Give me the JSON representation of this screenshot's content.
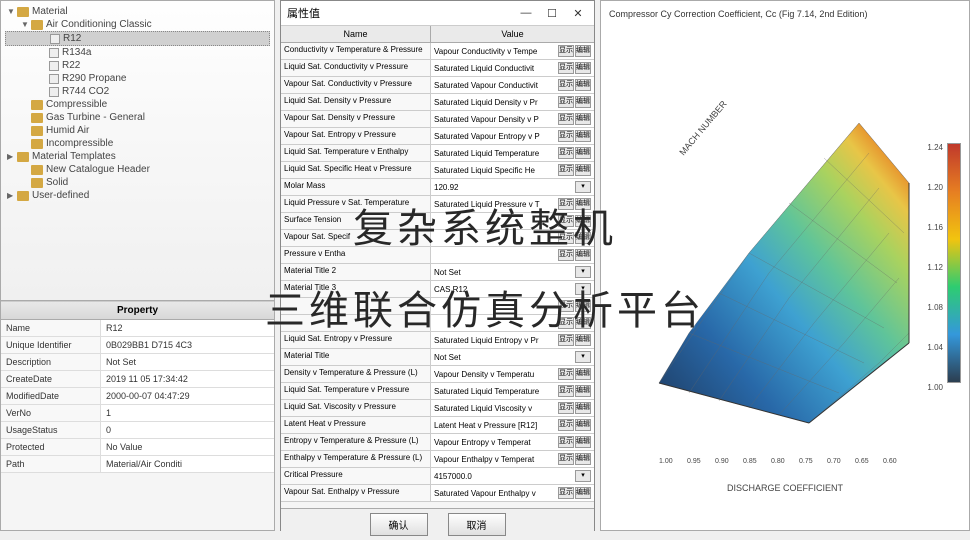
{
  "tree": {
    "root": "Material",
    "items": [
      {
        "indent": 0,
        "toggle": "▼",
        "icon": "folder",
        "label": "Material"
      },
      {
        "indent": 1,
        "toggle": "▼",
        "icon": "folder",
        "label": "Air Conditioning Classic"
      },
      {
        "indent": 2,
        "toggle": "",
        "icon": "file",
        "label": "R12",
        "selected": true
      },
      {
        "indent": 2,
        "toggle": "",
        "icon": "file",
        "label": "R134a"
      },
      {
        "indent": 2,
        "toggle": "",
        "icon": "file",
        "label": "R22"
      },
      {
        "indent": 2,
        "toggle": "",
        "icon": "file",
        "label": "R290 Propane"
      },
      {
        "indent": 2,
        "toggle": "",
        "icon": "file",
        "label": "R744 CO2"
      },
      {
        "indent": 1,
        "toggle": "",
        "icon": "folder",
        "label": "Compressible"
      },
      {
        "indent": 1,
        "toggle": "",
        "icon": "folder",
        "label": "Gas Turbine - General"
      },
      {
        "indent": 1,
        "toggle": "",
        "icon": "folder",
        "label": "Humid Air"
      },
      {
        "indent": 1,
        "toggle": "",
        "icon": "folder",
        "label": "Incompressible"
      },
      {
        "indent": 0,
        "toggle": "▶",
        "icon": "folder",
        "label": "Material Templates"
      },
      {
        "indent": 1,
        "toggle": "",
        "icon": "folder",
        "label": "New Catalogue Header"
      },
      {
        "indent": 1,
        "toggle": "",
        "icon": "folder",
        "label": "Solid"
      },
      {
        "indent": 0,
        "toggle": "▶",
        "icon": "folder",
        "label": "User-defined"
      }
    ]
  },
  "property": {
    "header": "Property",
    "rows": [
      {
        "k": "Name",
        "v": "R12"
      },
      {
        "k": "Unique Identifier",
        "v": "0B029BB1 D715 4C3"
      },
      {
        "k": "Description",
        "v": "Not Set"
      },
      {
        "k": "CreateDate",
        "v": "2019 11 05 17:34:42"
      },
      {
        "k": "ModifiedDate",
        "v": "2000-00-07 04:47:29"
      },
      {
        "k": "VerNo",
        "v": "1"
      },
      {
        "k": "UsageStatus",
        "v": "0"
      },
      {
        "k": "Protected",
        "v": "No Value"
      },
      {
        "k": "Path",
        "v": "Material/Air Conditi"
      }
    ]
  },
  "dialog": {
    "title": "属性值",
    "col_name": "Name",
    "col_value": "Value",
    "btn_show": "显示",
    "btn_edit": "编辑",
    "rows": [
      {
        "n": "Conductivity v Temperature & Pressure",
        "v": "Vapour Conductivity v Tempe",
        "b": true
      },
      {
        "n": "Liquid Sat. Conductivity v Pressure",
        "v": "Saturated Liquid Conductivit",
        "b": true
      },
      {
        "n": "Vapour Sat. Conductivity v Pressure",
        "v": "Saturated Vapour Conductivit",
        "b": true
      },
      {
        "n": "Liquid Sat. Density v Pressure",
        "v": "Saturated Liquid Density v Pr",
        "b": true
      },
      {
        "n": "Vapour Sat. Density v Pressure",
        "v": "Saturated Vapour Density v P",
        "b": true
      },
      {
        "n": "Vapour Sat. Entropy v Pressure",
        "v": "Saturated Vapour Entropy v P",
        "b": true
      },
      {
        "n": "Liquid Sat. Temperature v Enthalpy",
        "v": "Saturated Liquid Temperature",
        "b": true
      },
      {
        "n": "Liquid Sat. Specific Heat v Pressure",
        "v": "Saturated Liquid Specific He",
        "b": true
      },
      {
        "n": "Molar Mass",
        "v": "120.92",
        "b": false
      },
      {
        "n": "Liquid Pressure v Sat. Temperature",
        "v": "Saturated Liquid Pressure v T",
        "b": true
      },
      {
        "n": "Surface Tension",
        "v": "",
        "b": true
      },
      {
        "n": "Vapour Sat. Specif",
        "v": "",
        "b": true
      },
      {
        "n": "Pressure v Entha",
        "v": "",
        "b": true
      },
      {
        "n": "Material Title 2",
        "v": "Not Set",
        "b": false
      },
      {
        "n": "Material Title 3",
        "v": "CAS R12",
        "b": false
      },
      {
        "n": "",
        "v": "",
        "b": true
      },
      {
        "n": "",
        "v": "",
        "b": true
      },
      {
        "n": "Liquid Sat. Entropy v Pressure",
        "v": "Saturated Liquid Entropy v Pr",
        "b": true
      },
      {
        "n": "Material Title",
        "v": "Not Set",
        "b": false
      },
      {
        "n": "Density v Temperature & Pressure (L)",
        "v": "Vapour Density v Temperatu",
        "b": true
      },
      {
        "n": "Liquid Sat. Temperature v Pressure",
        "v": "Saturated Liquid Temperature",
        "b": true
      },
      {
        "n": "Liquid Sat. Viscosity v Pressure",
        "v": "Saturated Liquid Viscosity v",
        "b": true
      },
      {
        "n": "Latent Heat v Pressure",
        "v": "Latent Heat v Pressure [R12]",
        "b": true
      },
      {
        "n": "Entropy v Temperature & Pressure (L)",
        "v": "Vapour Entropy v Temperat",
        "b": true
      },
      {
        "n": "Enthalpy v Temperature & Pressure (L)",
        "v": "Vapour Enthalpy v Temperat",
        "b": true
      },
      {
        "n": "Critical Pressure",
        "v": "4157000.0",
        "b": false
      },
      {
        "n": "Vapour Sat. Enthalpy v Pressure",
        "v": "Saturated Vapour Enthalpy v",
        "b": true
      }
    ],
    "ok": "确认",
    "cancel": "取消"
  },
  "chart": {
    "title": "Compressor Cy Correction Coefficient, Cc (Fig 7.14, 2nd Edition)",
    "xlabel": "DISCHARGE COEFFICIENT",
    "ylabel": "",
    "zlabel": "MACH NUMBER",
    "colorbar_ticks": [
      "1.24",
      "1.20",
      "1.16",
      "1.12",
      "1.08",
      "1.04",
      "1.00"
    ],
    "x_ticks": [
      "1.00",
      "0.95",
      "0.90",
      "0.85",
      "0.80",
      "0.75",
      "0.70",
      "0.65",
      "0.60"
    ]
  },
  "chart_data": {
    "type": "surface",
    "title": "Compressor Cy Correction Coefficient, Cc (Fig 7.14, 2nd Edition)",
    "xlabel": "DISCHARGE COEFFICIENT",
    "zlabel": "MACH NUMBER",
    "x_range": [
      0.6,
      1.0
    ],
    "z_range": [
      1.0,
      1.24
    ],
    "colorbar_range": [
      1.0,
      1.24
    ]
  },
  "overlay": {
    "line1": "复杂系统整机",
    "line2": "三维联合仿真分析平台"
  }
}
